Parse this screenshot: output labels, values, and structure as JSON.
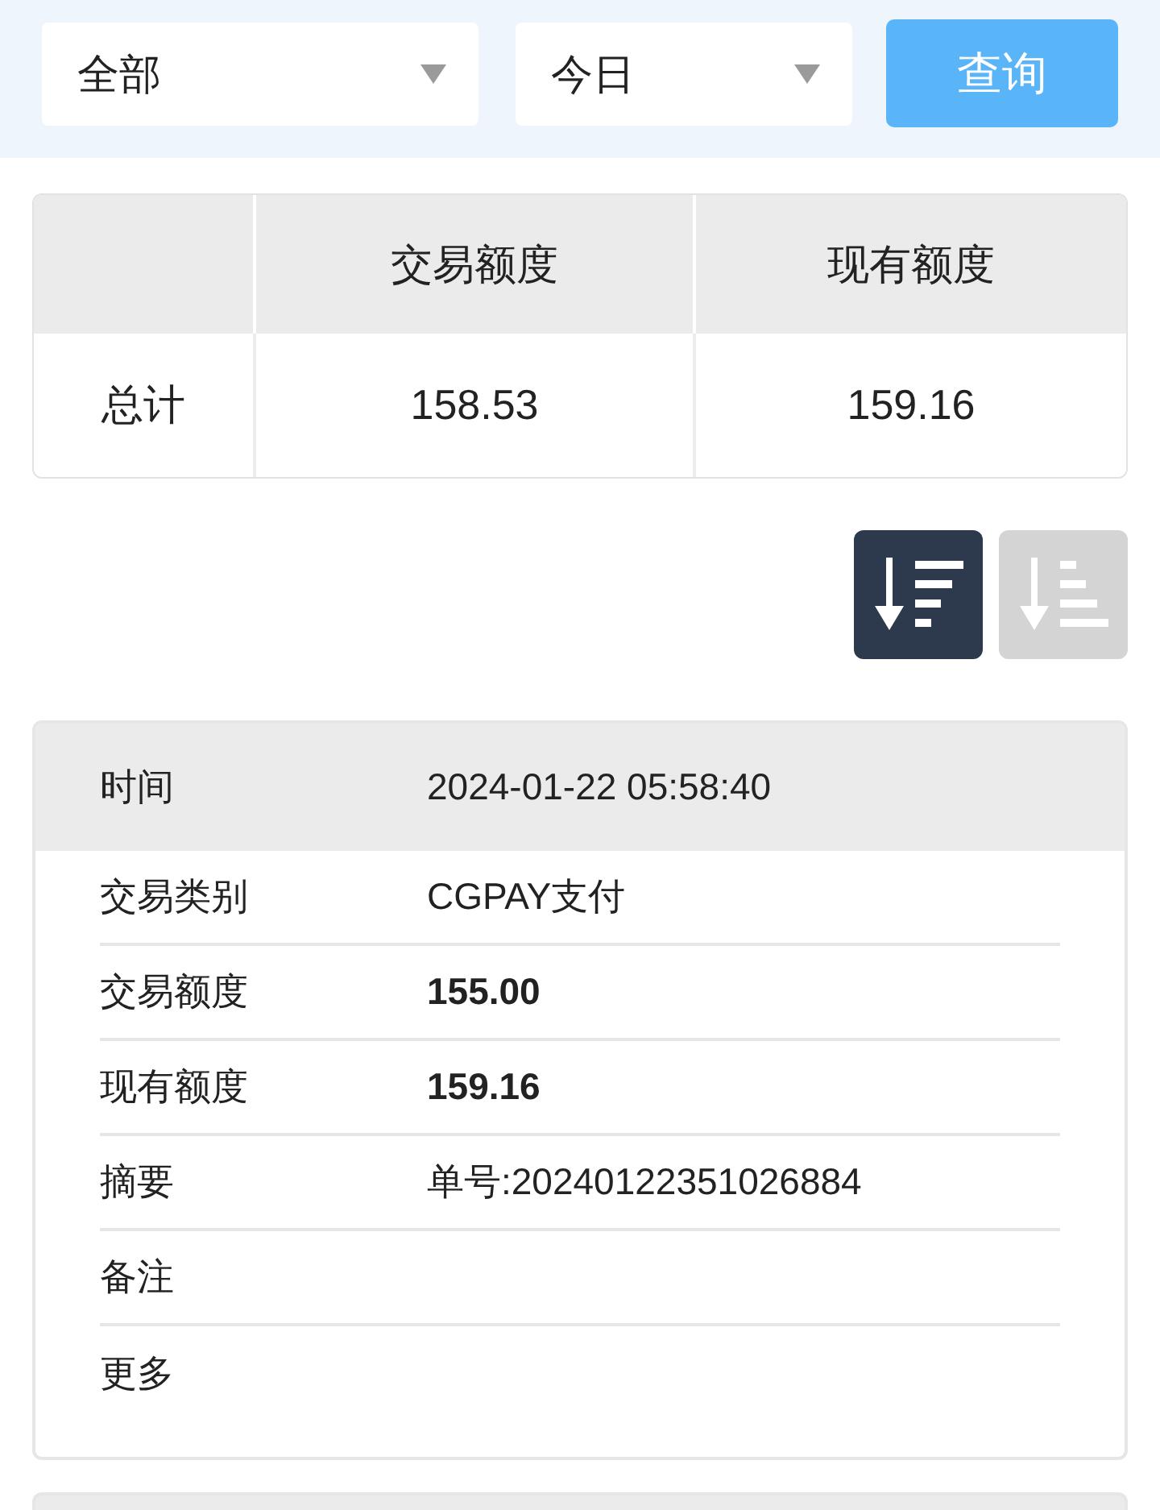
{
  "filters": [
    {
      "value": "全部"
    },
    {
      "value": "今日"
    }
  ],
  "query_button": "查询",
  "summary": {
    "columns": [
      "交易额度",
      "现有额度"
    ],
    "rows": [
      {
        "label": "总计",
        "cells": [
          "158.53",
          "159.16"
        ]
      }
    ]
  },
  "sort_buttons": [
    {
      "kind": "descending",
      "selected": true
    },
    {
      "kind": "ascending",
      "selected": false
    }
  ],
  "records": [
    {
      "fields": [
        {
          "kind": "header",
          "label": "时间",
          "value": "2024-01-22 05:58:40"
        },
        {
          "kind": "plain",
          "label": "交易类别",
          "value": "CGPAY支付"
        },
        {
          "kind": "amount",
          "label": "交易额度",
          "value": "155.00"
        },
        {
          "kind": "amount",
          "label": "现有额度",
          "value": "159.16"
        },
        {
          "kind": "plain",
          "label": "摘要",
          "value": "单号:20240122351026884"
        },
        {
          "kind": "plain",
          "label": "备注"
        },
        {
          "kind": "plain",
          "label": "更多"
        }
      ]
    }
  ]
}
